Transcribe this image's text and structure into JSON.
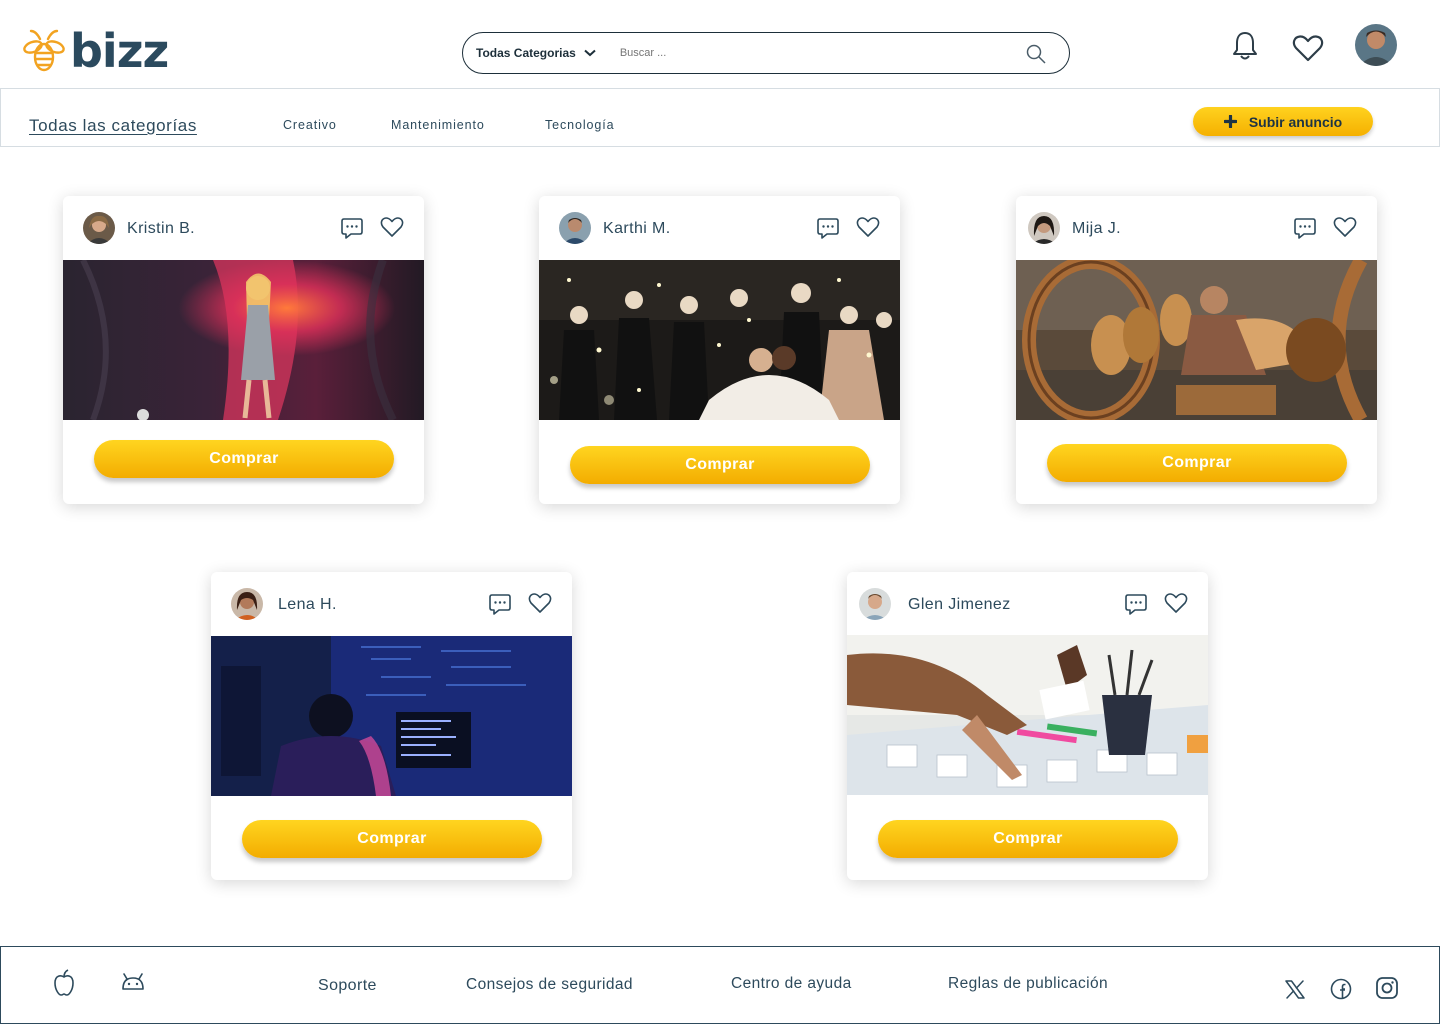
{
  "brand": {
    "name": "bizz"
  },
  "search": {
    "category": "Todas Categorias",
    "placeholder": "Buscar ..."
  },
  "categories": {
    "all": "Todas las categorías",
    "items": [
      "Creativo",
      "Mantenimiento",
      "Tecnología"
    ]
  },
  "upload_button": "Subir anuncio",
  "cards": [
    {
      "name": "Kristin B.",
      "buy": "Comprar"
    },
    {
      "name": "Karthi M.",
      "buy": "Comprar"
    },
    {
      "name": "Mija J.",
      "buy": "Comprar"
    },
    {
      "name": "Lena H.",
      "buy": "Comprar"
    },
    {
      "name": "Glen Jimenez",
      "buy": "Comprar"
    }
  ],
  "footer": {
    "links": [
      "Soporte",
      "Consejos de seguridad",
      "Centro de ayuda",
      "Reglas de publicación"
    ]
  },
  "colors": {
    "accent": "#f7b500",
    "primary": "#2d4a5c"
  }
}
